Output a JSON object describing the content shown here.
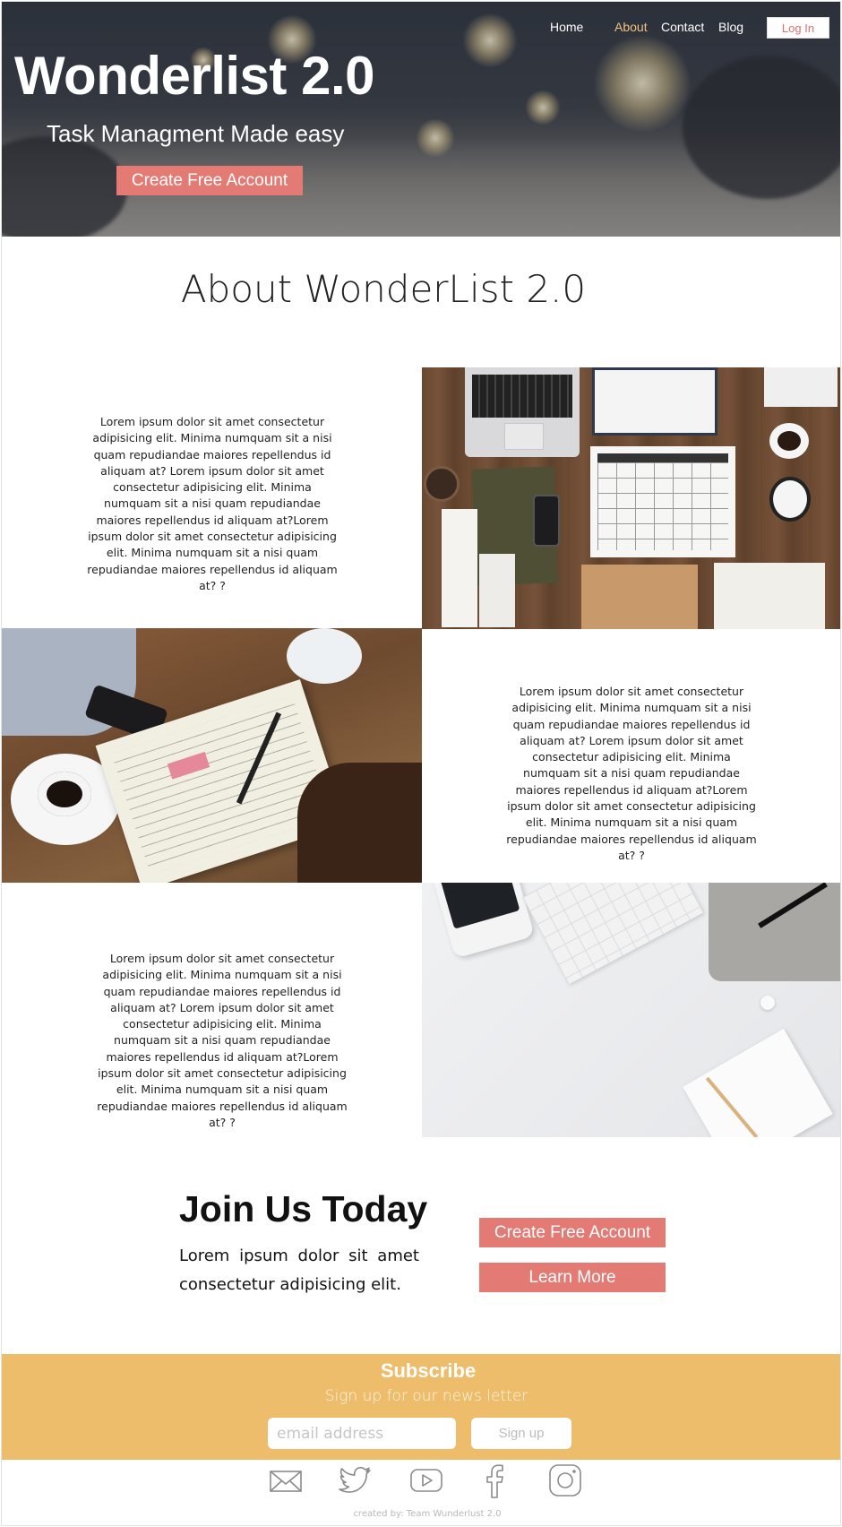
{
  "nav": {
    "items": [
      "Home",
      "About",
      "Contact",
      "Blog"
    ],
    "active": "About",
    "login_label": "Log In"
  },
  "hero": {
    "title": "Wonderlist 2.0",
    "subtitle": "Task Managment Made easy",
    "cta_label": "Create Free Account"
  },
  "about": {
    "title": "About WonderList 2.0",
    "paragraphs": [
      "Lorem ipsum dolor sit amet consectetur adipisicing elit. Minima numquam sit a nisi quam repudiandae maiores repellendus id aliquam at? Lorem ipsum dolor sit amet consectetur adipisicing elit. Minima numquam sit a nisi quam repudiandae maiores repellendus id aliquam at?Lorem ipsum dolor sit amet consectetur adipisicing elit. Minima numquam sit a nisi quam repudiandae maiores repellendus id aliquam at? ?",
      "Lorem ipsum dolor sit amet consectetur adipisicing elit. Minima numquam sit a nisi quam repudiandae maiores repellendus id aliquam at? Lorem ipsum dolor sit amet consectetur adipisicing elit. Minima numquam sit a nisi quam repudiandae maiores repellendus id aliquam at?Lorem ipsum dolor sit amet consectetur adipisicing elit. Minima numquam sit a nisi quam repudiandae maiores repellendus id aliquam at? ?",
      "Lorem ipsum dolor sit amet consectetur adipisicing elit. Minima numquam sit a nisi quam repudiandae maiores repellendus id aliquam at? Lorem ipsum dolor sit amet consectetur adipisicing elit. Minima numquam sit a nisi quam repudiandae maiores repellendus id aliquam at?Lorem ipsum dolor sit amet consectetur adipisicing elit. Minima numquam sit a nisi quam repudiandae maiores repellendus id aliquam at? ?"
    ]
  },
  "join": {
    "title": "Join Us Today",
    "text": "Lorem ipsum dolor sit amet consectetur adipisicing elit.",
    "primary_label": "Create Free Account",
    "secondary_label": "Learn More"
  },
  "subscribe": {
    "title": "Subscribe",
    "text": "Sign up for our news letter",
    "email_placeholder": "email address",
    "button_label": "Sign up"
  },
  "social": {
    "icons": [
      "mail-icon",
      "twitter-icon",
      "youtube-icon",
      "facebook-icon",
      "instagram-icon"
    ]
  },
  "footer": {
    "credit": "created by:  Team Wunderlust 2.0"
  },
  "colors": {
    "accent": "#e47a74",
    "nav_active": "#f2c27d",
    "subscribe_bg": "#eebd6c"
  }
}
